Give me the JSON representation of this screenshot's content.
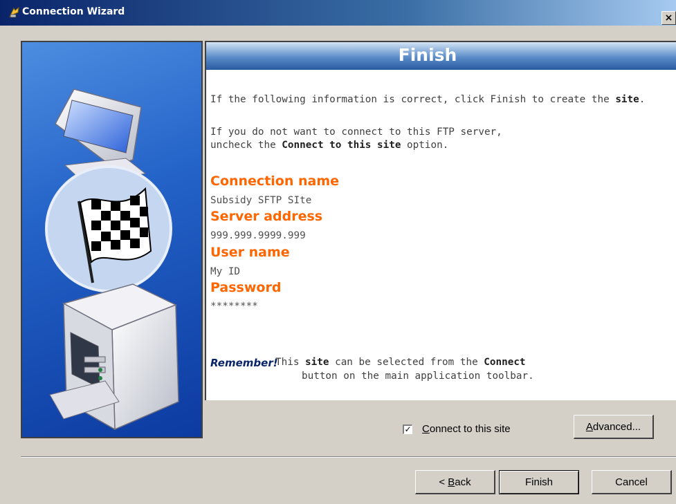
{
  "window": {
    "title": "Connection Wizard",
    "close_glyph": "×"
  },
  "header": {
    "title": "Finish"
  },
  "intro": {
    "line1_pre": "If the following information is correct, click Finish to create the ",
    "line1_bold": "site",
    "line1_post": ".",
    "line2": "If you do not want to connect to this FTP server,",
    "line3_pre": "uncheck the ",
    "line3_bold": "Connect to this site",
    "line3_post": " option."
  },
  "fields": [
    {
      "label": "Connection name",
      "value": "Subsidy SFTP SIte"
    },
    {
      "label": "Server address",
      "value": "999.999.9999.999"
    },
    {
      "label": "User name",
      "value": "My ID"
    },
    {
      "label": "Password",
      "value": "********"
    }
  ],
  "remember": {
    "label": "Remember!",
    "text1_pre": " This ",
    "text1_bold1": "site",
    "text1_mid": " can be selected from the ",
    "text1_bold2": "Connect",
    "text2": "button on the main application toolbar."
  },
  "options": {
    "connect_checkbox": {
      "label_access": "C",
      "label_rest": "onnect to this site",
      "checked": true
    },
    "advanced_button": {
      "label_access": "A",
      "label_rest": "dvanced..."
    }
  },
  "footer": {
    "back_pre": "< ",
    "back_access": "B",
    "back_rest": "ack",
    "finish": "Finish",
    "cancel": "Cancel"
  },
  "icons": {
    "title": "connection-wizard-icon",
    "illustration": "computers-finish-flag-illustration"
  },
  "colors": {
    "title_gradient_start": "#0a246a",
    "label_orange": "#ff6600",
    "remember_blue": "#0a246a",
    "panel_blue": "#1c56c0",
    "dialog_bg": "#d4d0c8"
  }
}
